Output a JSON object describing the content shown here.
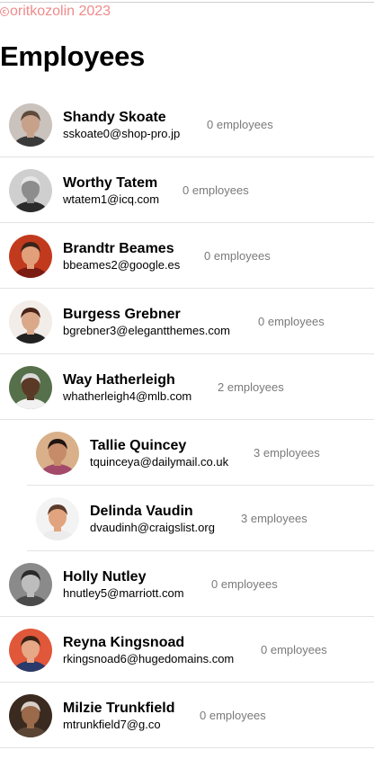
{
  "footer": {
    "copyright_icon": "copyright-icon",
    "copyright_text": "oritkozolin 2023"
  },
  "page": {
    "title": "Employees"
  },
  "employees": [
    {
      "name": "Shandy Skoate",
      "email": "sskoate0@shop-pro.jp",
      "count": "0 employees",
      "avatar": {
        "bg": "#c9c2bd",
        "skin": "#c7a189",
        "hair": "#5e4a3a",
        "shirt": "#3a3a3a"
      }
    },
    {
      "name": "Worthy Tatem",
      "email": "wtatem1@icq.com",
      "count": "0 employees",
      "avatar": {
        "bg": "#cfcfcf",
        "skin": "#8d8d8d",
        "hair": "#e6e6e6",
        "shirt": "#2b2b2b"
      }
    },
    {
      "name": "Brandtr Beames",
      "email": "bbeames2@google.es",
      "count": "0 employees",
      "avatar": {
        "bg": "#c23a1e",
        "skin": "#e1a07a",
        "hair": "#3a241a",
        "shirt": "#7a1c12"
      }
    },
    {
      "name": "Burgess Grebner",
      "email": "bgrebner3@elegantthemes.com",
      "count": "0 employees",
      "avatar": {
        "bg": "#f2ede9",
        "skin": "#d9a98a",
        "hair": "#4a2418",
        "shirt": "#222222"
      }
    },
    {
      "name": "Way Hatherleigh",
      "email": "whatherleigh4@mlb.com",
      "count": "2 employees",
      "avatar": {
        "bg": "#55704a",
        "skin": "#5a3a26",
        "hair": "#d9d9d9",
        "shirt": "#f1f1f1"
      }
    },
    {
      "name": "Tallie Quincey",
      "email": "tquinceya@dailymail.co.uk",
      "count": "3 employees",
      "avatar": {
        "bg": "#d9b08a",
        "skin": "#c68b68",
        "hair": "#1e1410",
        "shirt": "#a34a6a"
      }
    },
    {
      "name": "Delinda Vaudin",
      "email": "dvaudinh@craigslist.org",
      "count": "3 employees",
      "avatar": {
        "bg": "#f3f3f3",
        "skin": "#e2a47e",
        "hair": "#5a3a2a",
        "shirt": "#ececec"
      }
    },
    {
      "name": "Holly Nutley",
      "email": "hnutley5@marriott.com",
      "count": "0 employees",
      "avatar": {
        "bg": "#8a8a8a",
        "skin": "#bdbdbd",
        "hair": "#2a2a2a",
        "shirt": "#4a4a4a"
      }
    },
    {
      "name": "Reyna Kingsnoad",
      "email": "rkingsnoad6@hugedomains.com",
      "count": "0 employees",
      "avatar": {
        "bg": "#e0573a",
        "skin": "#e7a887",
        "hair": "#3a2418",
        "shirt": "#2a3a6a"
      }
    },
    {
      "name": "Milzie Trunkfield",
      "email": "mtrunkfield7@g.co",
      "count": "0 employees",
      "avatar": {
        "bg": "#3a2a20",
        "skin": "#9a6a4a",
        "hair": "#d8d0c8",
        "shirt": "#5a4434"
      }
    }
  ]
}
